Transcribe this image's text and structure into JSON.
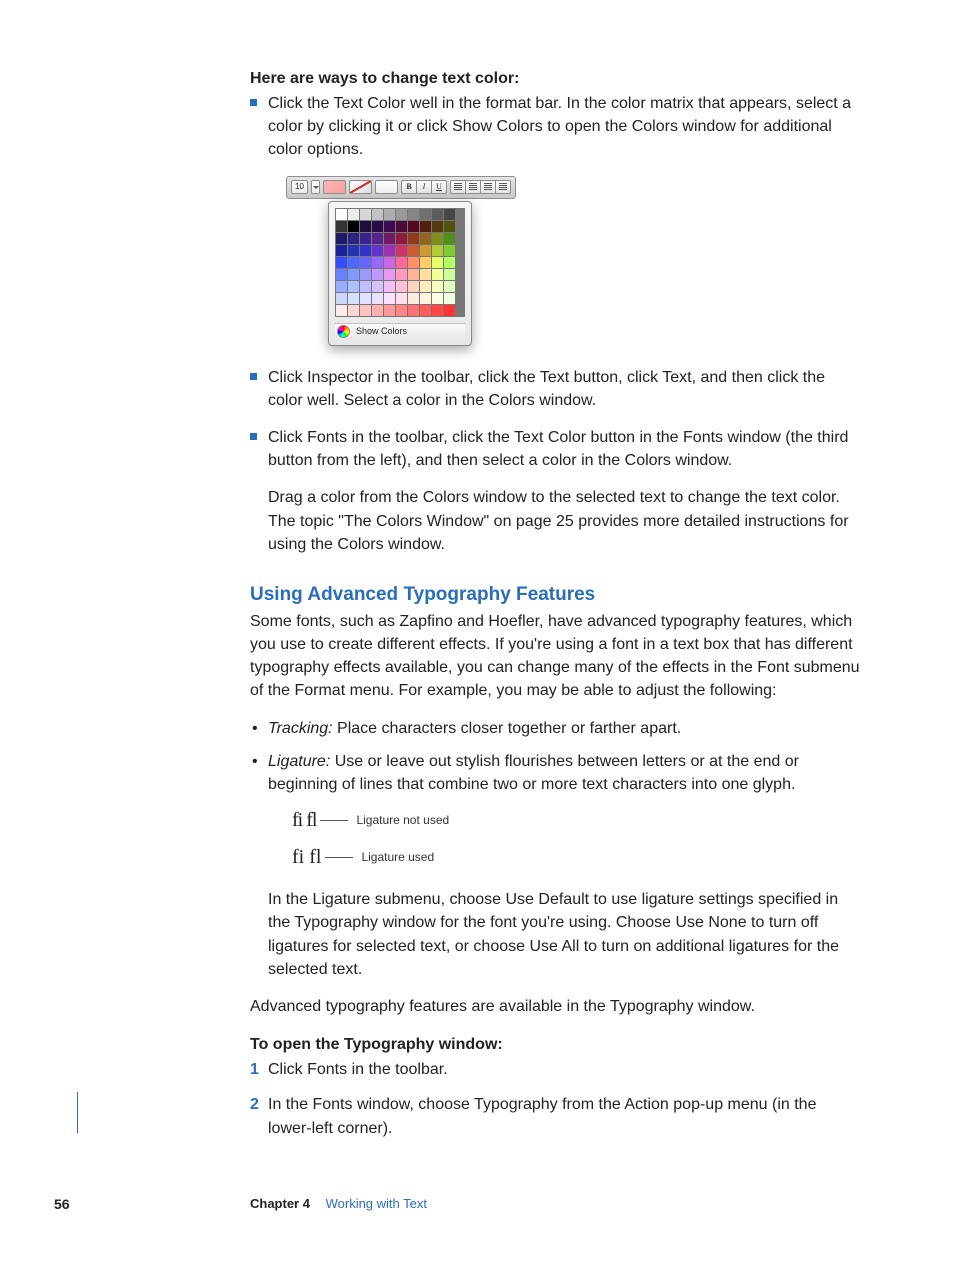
{
  "intro_heading": "Here are ways to change text color:",
  "bullets_main": [
    "Click the Text Color well in the format bar. In the color matrix that appears, select a color by clicking it or click Show Colors to open the Colors window for additional color options.",
    "Click Inspector in the toolbar, click the Text button, click Text, and then click the color well. Select a color in the Colors window.",
    "Click Fonts in the toolbar, click the Text Color button in the Fonts window (the third button from the left), and then select a color in the Colors window."
  ],
  "drag_para": "Drag a color from the Colors window to the selected text to change the text color. The topic \"The Colors Window\" on page 25 provides more detailed instructions for using the Colors window.",
  "section_heading": "Using Advanced Typography Features",
  "section_intro": "Some fonts, such as Zapfino and Hoefler, have advanced typography features, which you use to create different effects. If you're using a font in a text box that has different typography effects available, you can change many of the effects in the Font submenu of the Format menu. For example, you may be able to adjust the following:",
  "typo_items": [
    {
      "term": "Tracking:",
      "desc": " Place characters closer together or farther apart."
    },
    {
      "term": "Ligature:",
      "desc": " Use or leave out stylish flourishes between letters or at the end or beginning of lines that combine two or more text characters into one glyph."
    }
  ],
  "ligature_labels": {
    "not_used_glyph": "fi fl",
    "not_used": "Ligature not used",
    "used_glyph": "fi fl",
    "used": "Ligature used"
  },
  "ligature_para": "In the Ligature submenu, choose Use Default to use ligature settings specified in the Typography window for the font you're using. Choose Use None to turn off ligatures for selected text, or choose Use All to turn on additional ligatures for the selected text.",
  "advanced_para": "Advanced typography features are available in the Typography window.",
  "steps_heading": "To open the Typography window:",
  "steps": [
    "Click Fonts in the toolbar.",
    "In the Fonts window, choose Typography from the Action pop-up menu (in the lower-left corner)."
  ],
  "toolbar": {
    "fontsize": "10",
    "B": "B",
    "I": "I",
    "U": "U",
    "show_colors": "Show Colors"
  },
  "footer": {
    "page": "56",
    "chapter": "Chapter 4",
    "title": "Working with Text"
  },
  "palette_colors": [
    "#ffffff",
    "#ebebeb",
    "#d6d6d6",
    "#c2c2c2",
    "#adadad",
    "#999999",
    "#858585",
    "#707070",
    "#5c5c5c",
    "#474747",
    "#333333",
    "#000000",
    "#1d0f3d",
    "#2a0a4a",
    "#3b0a52",
    "#4b0a3a",
    "#520a23",
    "#521f0a",
    "#523a0a",
    "#52520a",
    "#1d1a66",
    "#2a2380",
    "#3b238f",
    "#57238f",
    "#731a66",
    "#8f1a3d",
    "#8f3b1a",
    "#8f661a",
    "#808f1a",
    "#528f1a",
    "#1a2399",
    "#2333b3",
    "#3333cc",
    "#6633cc",
    "#9933b3",
    "#cc3366",
    "#cc5c33",
    "#cc9933",
    "#b3cc33",
    "#80cc33",
    "#334dff",
    "#4d66ff",
    "#6666ff",
    "#9966ff",
    "#cc66e6",
    "#ff6699",
    "#ff8f66",
    "#ffcc66",
    "#e6ff66",
    "#b3ff66",
    "#6680ff",
    "#8099ff",
    "#9999ff",
    "#bf99ff",
    "#e699f2",
    "#ff99bf",
    "#ffb399",
    "#ffe099",
    "#f2ff99",
    "#ccff99",
    "#99adff",
    "#adbfff",
    "#bfbfff",
    "#d6bfff",
    "#f0bff7",
    "#ffbfd6",
    "#ffd1bf",
    "#ffecbf",
    "#f7ffbf",
    "#e0ffbf",
    "#ccd6ff",
    "#d6e0ff",
    "#e0e0ff",
    "#ece0ff",
    "#f9e0fc",
    "#ffe0ec",
    "#ffeae0",
    "#fff6e0",
    "#fcffe0",
    "#f0ffe0",
    "#ffebeb",
    "#ffd6d6",
    "#ffc2c2",
    "#ffadad",
    "#ff9999",
    "#ff8585",
    "#ff7070",
    "#ff5c5c",
    "#ff4747",
    "#ff3333"
  ]
}
